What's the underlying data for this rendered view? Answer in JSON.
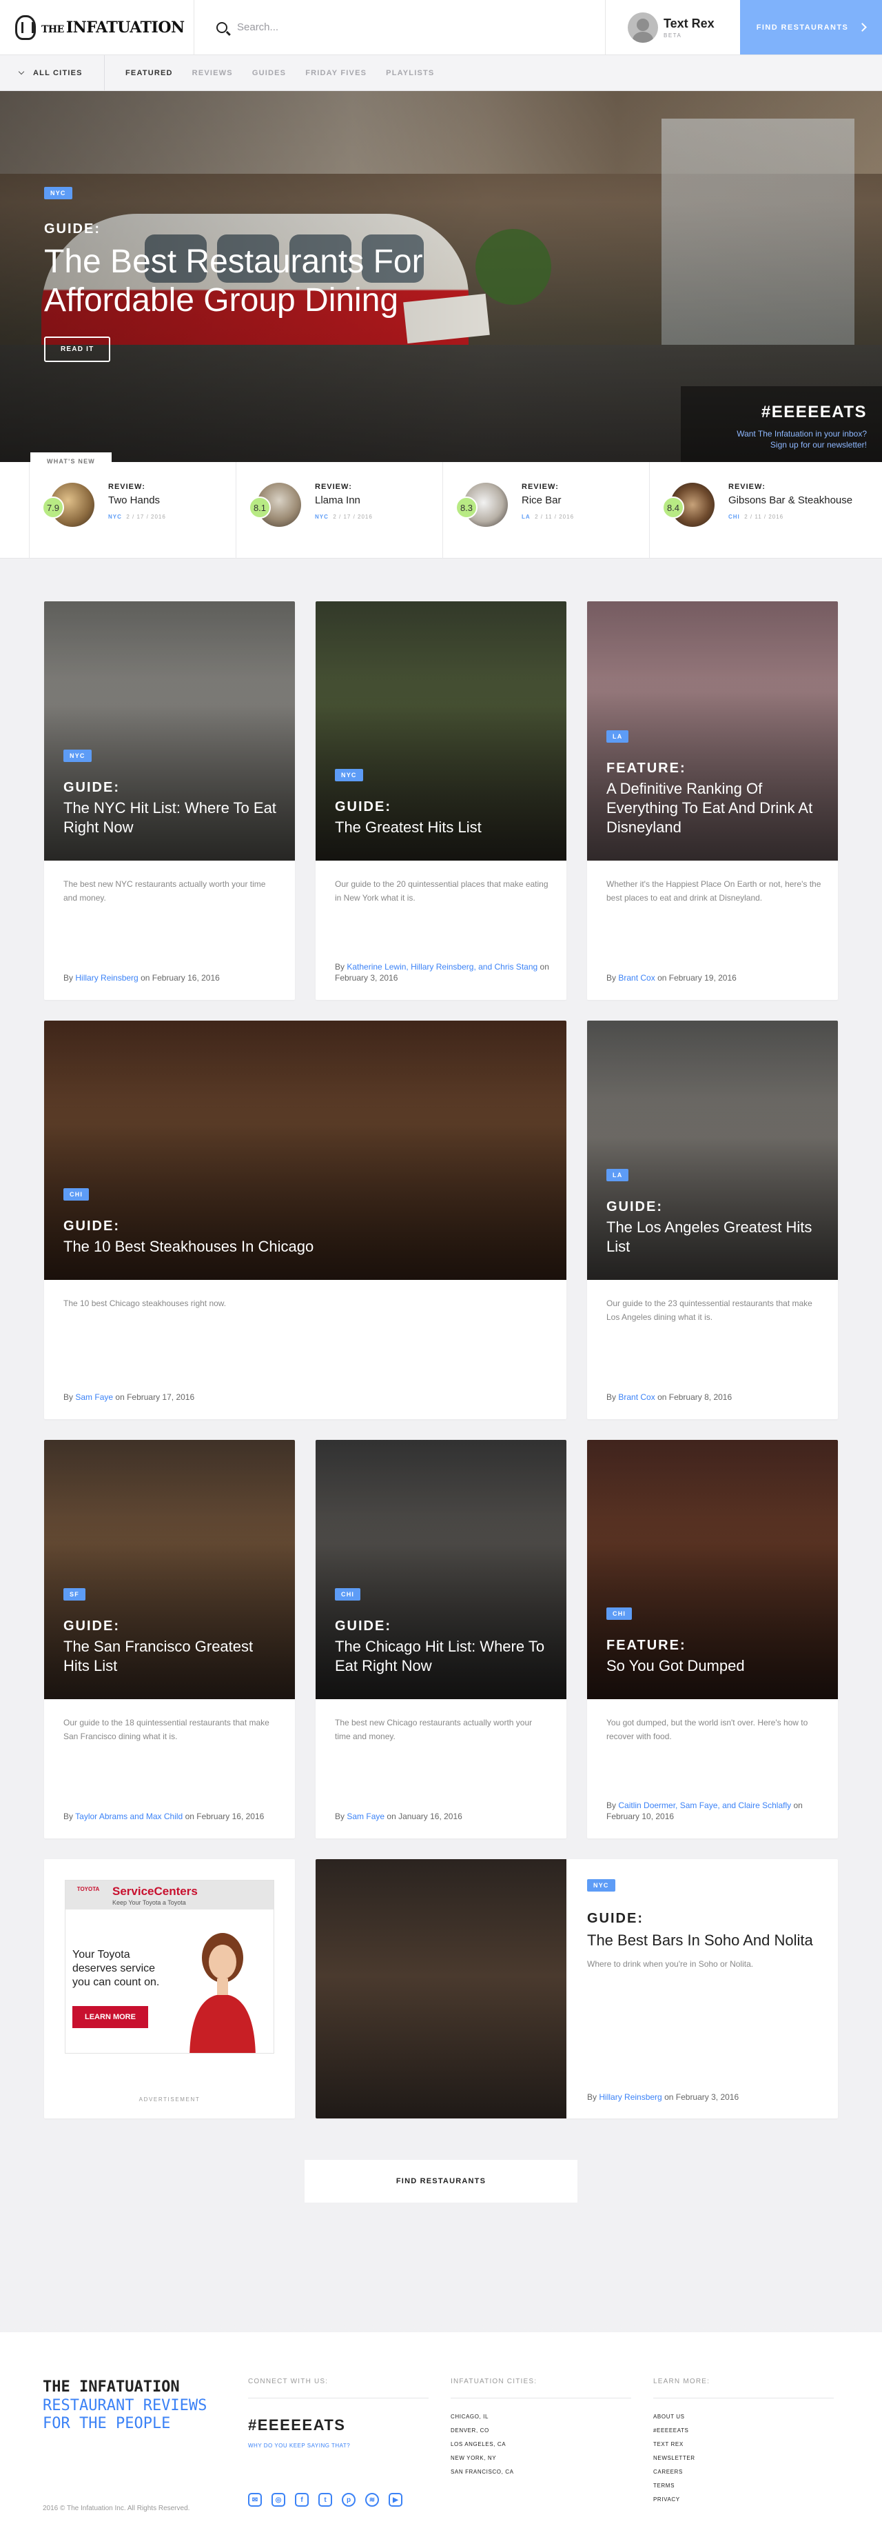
{
  "header": {
    "logo_small": "THE",
    "logo_text": "INFATUATION",
    "search_placeholder": "Search...",
    "textrex_title": "Text Rex",
    "textrex_badge": "BETA",
    "find_button": "FIND RESTAURANTS"
  },
  "subnav": {
    "cities_label": "ALL CITIES",
    "tabs": [
      "FEATURED",
      "REVIEWS",
      "GUIDES",
      "FRIDAY FIVES",
      "PLAYLISTS"
    ]
  },
  "hero": {
    "tag": "NYC",
    "label": "GUIDE:",
    "title": "The Best Restaurants For Affordable Group Dining",
    "button": "READ IT",
    "promo_tag": "#EEEEEATS",
    "promo_line1": "Want The Infatuation in your inbox?",
    "promo_line2": "Sign up for our newsletter!"
  },
  "whats_new": {
    "label": "WHAT'S NEW",
    "items": [
      {
        "kicker": "REVIEW:",
        "name": "Two Hands",
        "score": "7.9",
        "city": "NYC",
        "date": "2 / 17 / 2016"
      },
      {
        "kicker": "REVIEW:",
        "name": "Llama Inn",
        "score": "8.1",
        "city": "NYC",
        "date": "2 / 17 / 2016"
      },
      {
        "kicker": "REVIEW:",
        "name": "Rice Bar",
        "score": "8.3",
        "city": "LA",
        "date": "2 / 11 / 2016"
      },
      {
        "kicker": "REVIEW:",
        "name": "Gibsons Bar & Steakhouse",
        "score": "8.4",
        "city": "CHI",
        "date": "2 / 11 / 2016"
      }
    ]
  },
  "cards": [
    {
      "tag": "NYC",
      "kicker": "GUIDE:",
      "title": "The NYC Hit List: Where To Eat Right Now",
      "desc": "The best new NYC restaurants actually worth your time and money.",
      "by": "By",
      "authors": "Hillary Reinsberg",
      "date": "on February 16, 2016"
    },
    {
      "tag": "NYC",
      "kicker": "GUIDE:",
      "title": "The Greatest Hits List",
      "desc": "Our guide to the 20 quintessential places that make eating in New York what it is.",
      "by": "By",
      "authors": "Katherine Lewin, Hillary Reinsberg, and Chris Stang",
      "date": "on February 3, 2016"
    },
    {
      "tag": "LA",
      "kicker": "FEATURE:",
      "title": "A Definitive Ranking Of Everything To Eat And Drink At Disneyland",
      "desc": "Whether it's the Happiest Place On Earth or not, here's the best places to eat and drink at Disneyland.",
      "by": "By",
      "authors": "Brant Cox",
      "date": "on February 19, 2016"
    },
    {
      "tag": "CHI",
      "kicker": "GUIDE:",
      "title": "The 10 Best Steakhouses In Chicago",
      "desc": "The 10 best Chicago steakhouses right now.",
      "by": "By",
      "authors": "Sam Faye",
      "date": "on February 17, 2016"
    },
    {
      "tag": "LA",
      "kicker": "GUIDE:",
      "title": "The Los Angeles Greatest Hits List",
      "desc": "Our guide to the 23 quintessential restaurants that make Los Angeles dining what it is.",
      "by": "By",
      "authors": "Brant Cox",
      "date": "on February 8, 2016"
    },
    {
      "tag": "SF",
      "kicker": "GUIDE:",
      "title": "The San Francisco Greatest Hits List",
      "desc": "Our guide to the 18 quintessential restaurants that make San Francisco dining what it is.",
      "by": "By",
      "authors": "Taylor Abrams and Max Child",
      "date": "on February 16, 2016"
    },
    {
      "tag": "CHI",
      "kicker": "GUIDE:",
      "title": "The Chicago Hit List: Where To Eat Right Now",
      "desc": "The best new Chicago restaurants actually worth your time and money.",
      "by": "By",
      "authors": "Sam Faye",
      "date": "on January 16, 2016"
    },
    {
      "tag": "CHI",
      "kicker": "FEATURE:",
      "title": "So You Got Dumped",
      "desc": "You got dumped, but the world isn't over. Here's how to recover with food.",
      "by": "By",
      "authors": "Caitlin Doermer, Sam Faye, and Claire Schlafly",
      "date": "on February 10, 2016"
    },
    {
      "tag": "NYC",
      "kicker": "GUIDE:",
      "title": "The Best Bars In Soho And Nolita",
      "desc": "Where to drink when you're in Soho or Nolita.",
      "by": "By",
      "authors": "Hillary Reinsberg",
      "date": "on February 3, 2016"
    }
  ],
  "ad": {
    "brand": "ServiceCenters",
    "brand_sub": "Keep Your Toyota a Toyota",
    "toyota": "TOYOTA",
    "line": "Your Toyota deserves service you can count on.",
    "button": "LEARN MORE",
    "label": "ADVERTISEMENT"
  },
  "load_more": "FIND RESTAURANTS",
  "footer": {
    "logo": "THE INFATUATION",
    "tagline": "RESTAURANT REVIEWS FOR THE PEOPLE",
    "copyright": "2016 © The Infatuation Inc. All Rights Reserved.",
    "connect_title": "CONNECT WITH US:",
    "hashtag": "#EEEEEATS",
    "why": "WHY DO YOU KEEP SAYING THAT?",
    "cities_title": "INFATUATION CITIES:",
    "cities": [
      "CHICAGO, IL",
      "DENVER, CO",
      "LOS ANGELES, CA",
      "NEW YORK, NY",
      "SAN FRANCISCO, CA"
    ],
    "learn_title": "LEARN MORE:",
    "learn": [
      "ABOUT US",
      "#EEEEEATS",
      "TEXT REX",
      "NEWSLETTER",
      "CAREERS",
      "TERMS",
      "PRIVACY"
    ],
    "socials": [
      "mail-icon",
      "instagram-icon",
      "facebook-icon",
      "twitter-icon",
      "pinterest-icon",
      "spotify-icon",
      "youtube-icon"
    ]
  },
  "colors": {
    "accent": "#5d9cf6",
    "score": "#b8ea84",
    "find_button": "#7fb2fb"
  }
}
